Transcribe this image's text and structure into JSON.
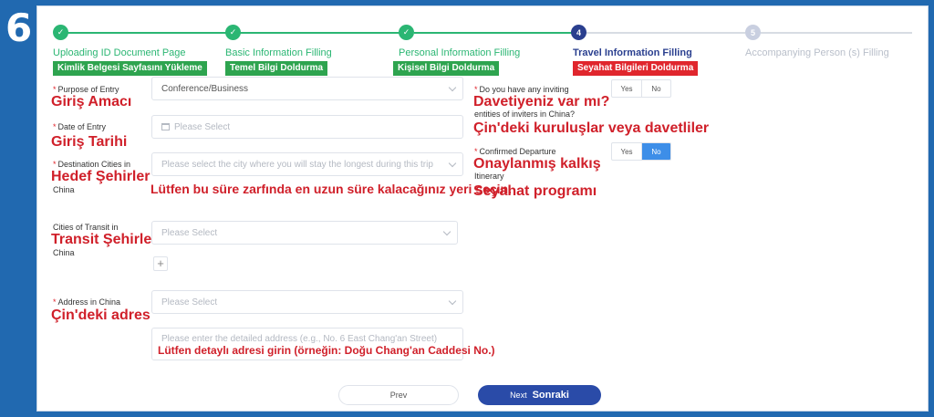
{
  "step_number": "6",
  "stepper": [
    {
      "label": "Uploading ID Document Page",
      "tr": "Kimlik Belgesi Sayfasını Yükleme",
      "state": "done",
      "num": ""
    },
    {
      "label": "Basic Information Filling",
      "tr": "Temel Bilgi Doldurma",
      "state": "done",
      "num": ""
    },
    {
      "label": "Personal Information Filling",
      "tr": "Kişisel Bilgi Doldurma",
      "state": "done",
      "num": ""
    },
    {
      "label": "Travel Information Filling",
      "tr": "Seyahat Bilgileri Doldurma",
      "state": "active",
      "num": "4"
    },
    {
      "label": "Accompanying Person (s) Filling",
      "tr": "",
      "state": "pending",
      "num": "5"
    }
  ],
  "icons": {
    "done": "checkmark-icon",
    "select": "chevron-down-icon",
    "date": "calendar-icon"
  },
  "colors": {
    "done": "#2bb673",
    "active": "#2a3f8f",
    "annotation": "#d0202a",
    "primary": "#2a4ba8",
    "toggle_on": "#3d8ee8",
    "frame": "#2169b0"
  },
  "form": {
    "purpose": {
      "label": "Purpose of Entry",
      "tr": "Giriş Amacı",
      "value": "Conference/Business"
    },
    "date": {
      "label": "Date of Entry",
      "tr": "Giriş Tarihi",
      "placeholder": "Please Select"
    },
    "destination": {
      "label": "Destination Cities in",
      "label2": "China",
      "tr": "Hedef Şehirler",
      "placeholder": "Please select the city where you will stay the longest during this trip",
      "tr_hint": "Lütfen bu süre zarfında en uzun süre kalacağınız yeri seçin."
    },
    "transit": {
      "label": "Cities of Transit in",
      "label2": "China",
      "tr": "Transit Şehirler",
      "placeholder": "Please Select",
      "add": "+"
    },
    "address": {
      "label": "Address in China",
      "tr": "Çin'deki adres",
      "placeholder": "Please Select",
      "detail_placeholder": "Please enter the detailed address (e.g., No. 6 East Chang'an Street)",
      "tr_hint": "Lütfen detaylı adresi girin (örneğin: Doğu Chang'an Caddesi No.)"
    },
    "inviting": {
      "label": "Do you have any inviting",
      "label2": "entities of inviters in China?",
      "tr": "Davetiyeniz var mı?",
      "tr2": "Çin'deki kuruluşlar veya davetliler",
      "yes": "Yes",
      "no": "No",
      "selected": "none"
    },
    "departure": {
      "label": "Confirmed Departure",
      "label2": "Itinerary",
      "tr": "Onaylanmış kalkış",
      "tr2": "Seyahat programı",
      "yes": "Yes",
      "no": "No",
      "selected": "no"
    },
    "required_mark": "*"
  },
  "buttons": {
    "prev": "Prev",
    "next": "Next",
    "next_tr": "Sonraki"
  }
}
